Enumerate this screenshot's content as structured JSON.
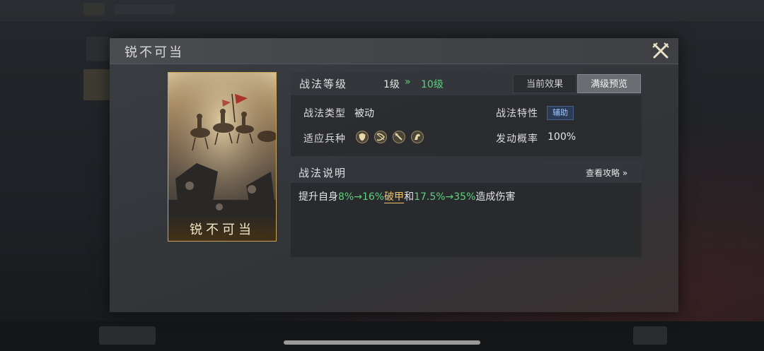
{
  "background": {
    "home_indicator": "home-indicator"
  },
  "modal": {
    "title": "锐不可当",
    "close_icon": "close-crossed-swords-icon"
  },
  "card": {
    "name": "锐不可当",
    "art": "cavalry-battle-illustration"
  },
  "level": {
    "label": "战法等级",
    "from": "1级",
    "arrow": "»",
    "to": "10级",
    "tabs": [
      {
        "label": "当前效果",
        "active": false
      },
      {
        "label": "满级预览",
        "active": true
      }
    ]
  },
  "info": {
    "type_label": "战法类型",
    "type_value": "被动",
    "trait_label": "战法特性",
    "trait_value": "辅助",
    "troops_label": "适应兵种",
    "troops": [
      "shield-icon",
      "bow-icon",
      "spear-icon",
      "horse-icon"
    ],
    "chance_label": "发动概率",
    "chance_value": "100%"
  },
  "description": {
    "title": "战法说明",
    "guide_link": "查看攻略 »",
    "text_prefix": "提升自身",
    "range1": "8%→16%",
    "keyword": "破甲",
    "text_mid": "和",
    "range2": "17.5%→35%",
    "text_suffix": "造成伤害"
  },
  "colors": {
    "highlight_green": "#5fd07c",
    "keyword_gold": "#f0c46a",
    "card_border": "#c9a55a",
    "trait_badge": "#2b3a55"
  }
}
